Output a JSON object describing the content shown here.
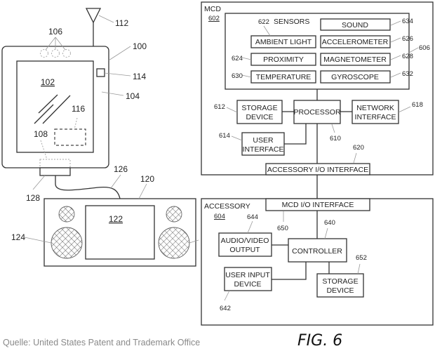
{
  "figure": {
    "title": "FIG. 6",
    "caption": "Quelle: United States Patent and Trademark Office"
  },
  "left_drawing": {
    "device_ref": "100",
    "screen_ref": "102",
    "body_ref": "104",
    "buttons_ref": "106",
    "connector_dashed_ref": "108",
    "antenna_ref": "112",
    "side_button_ref": "114",
    "internal_component_ref": "116",
    "accessory_ref": "120",
    "accessory_screen_ref": "122",
    "speaker_ref": "124",
    "cable_ref": "126",
    "plug_ref": "128"
  },
  "mcd": {
    "label": "MCD",
    "ref": "602",
    "sensors": {
      "label": "SENSORS",
      "label_ref": "622",
      "box_ref": "606",
      "items": [
        {
          "label": "SOUND",
          "ref": "634"
        },
        {
          "label": "AMBIENT LIGHT",
          "ref": "622"
        },
        {
          "label": "ACCELEROMETER",
          "ref": "626"
        },
        {
          "label": "PROXIMITY",
          "ref": "624"
        },
        {
          "label": "MAGNETOMETER",
          "ref": "628"
        },
        {
          "label": "TEMPERATURE",
          "ref": "630"
        },
        {
          "label": "GYROSCOPE",
          "ref": "632"
        }
      ]
    },
    "storage": {
      "line1": "STORAGE",
      "line2": "DEVICE",
      "ref": "612"
    },
    "processor": {
      "label": "PROCESSOR",
      "ref": "610"
    },
    "network": {
      "line1": "NETWORK",
      "line2": "INTERFACE",
      "ref": "618"
    },
    "user_interface": {
      "line1": "USER",
      "line2": "INTERFACE",
      "ref": "614"
    },
    "accessory_io": {
      "label": "ACCESSORY I/O INTERFACE",
      "ref": "620"
    }
  },
  "accessory": {
    "label": "ACCESSORY",
    "ref": "604",
    "mcd_io": {
      "label": "MCD I/O INTERFACE",
      "ref": "650"
    },
    "controller": {
      "label": "CONTROLLER",
      "ref": "640"
    },
    "av_output": {
      "line1": "AUDIO/VIDEO",
      "line2": "OUTPUT",
      "ref": "644"
    },
    "user_input": {
      "line1": "USER INPUT",
      "line2": "DEVICE",
      "ref": "642"
    },
    "storage": {
      "line1": "STORAGE",
      "line2": "DEVICE",
      "ref": "652"
    }
  }
}
